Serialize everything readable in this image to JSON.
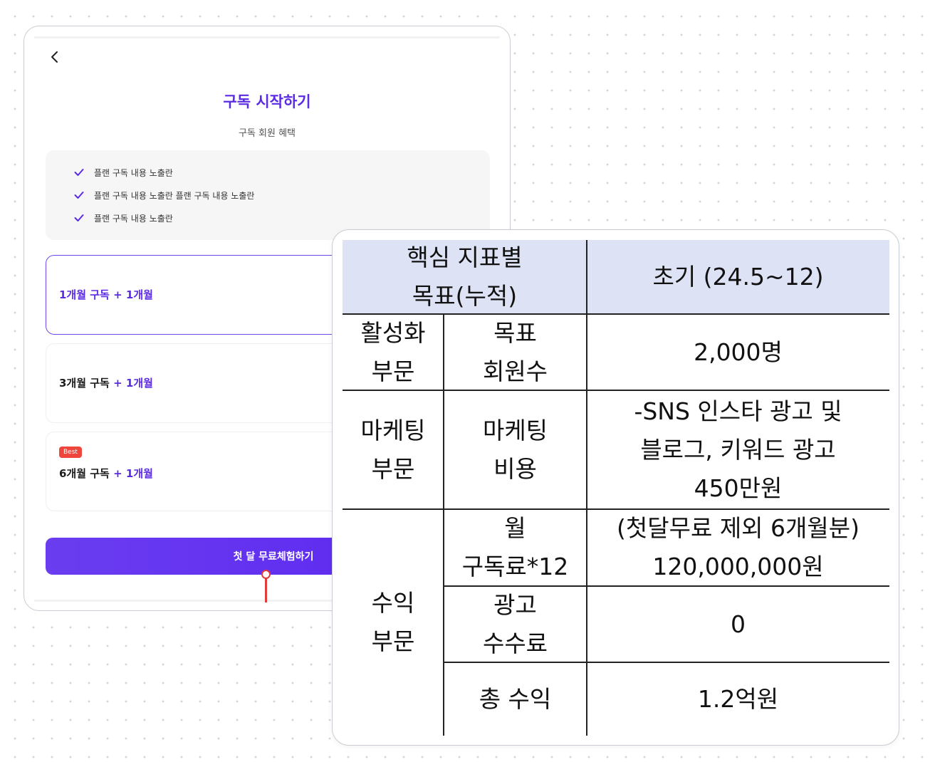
{
  "app": {
    "title": "구독 시작하기",
    "subtitle": "구독 회원 혜택",
    "benefits": [
      "플랜 구독 내용 노출란",
      "플랜 구독 내용 노출란 플랜 구독 내용 노출란",
      "플랜 구독 내용 노출란"
    ],
    "plans": [
      {
        "main": "1개월 구독",
        "bonus": " + 1개월",
        "selected": true
      },
      {
        "main": "3개월 구독",
        "bonus": " + 1개월",
        "selected": false
      },
      {
        "main": "6개월 구독",
        "bonus": " + 1개월",
        "selected": false,
        "badge": "Best"
      }
    ],
    "cta_label": "첫 달 무료체험하기",
    "icons": {
      "back": "chevron-left-icon",
      "check": "check-icon"
    },
    "colors": {
      "accent": "#5b2be3",
      "badge": "#f0453a",
      "pin": "#e23b3b"
    }
  },
  "table": {
    "header": {
      "metric": "핵심 지표별\n목표(누적)",
      "period": "초기 (24.5~12)"
    },
    "rows": {
      "activation": {
        "category": "활성화\n부문",
        "item": "목표\n회원수",
        "value": "2,000명"
      },
      "marketing": {
        "category": "마케팅\n부문",
        "item": "마케팅\n비용",
        "value": "-SNS 인스타 광고 및\n블로그, 키워드 광고\n450만원"
      },
      "revenue": {
        "category": "수익\n부문",
        "subscription": {
          "item": "월\n구독료*12",
          "value": "(첫달무료 제외 6개월분)\n120,000,000원"
        },
        "ads": {
          "item": "광고\n수수료",
          "value": "0"
        },
        "total": {
          "item": "총 수익",
          "value": "1.2억원"
        }
      }
    },
    "colors": {
      "header_bg": "#dde3f4"
    }
  }
}
